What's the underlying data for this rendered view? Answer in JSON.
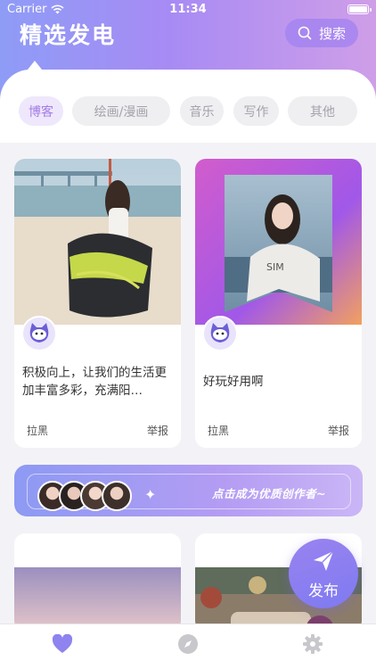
{
  "status_bar": {
    "carrier": "Carrier",
    "time": "11:34"
  },
  "header": {
    "title": "精选发电",
    "search_label": "搜索"
  },
  "categories": [
    {
      "label": "博客",
      "active": true
    },
    {
      "label": "绘画/漫画",
      "active": false
    },
    {
      "label": "音乐",
      "active": false
    },
    {
      "label": "写作",
      "active": false
    },
    {
      "label": "其他",
      "active": false
    }
  ],
  "posts": [
    {
      "text": "积极向上，让我们的生活更加丰富多彩，充满阳…",
      "block_label": "拉黑",
      "report_label": "举报"
    },
    {
      "text": "好玩好用啊",
      "block_label": "拉黑",
      "report_label": "举报"
    }
  ],
  "banner": {
    "text": "点击成为优质创作者~"
  },
  "publish": {
    "label": "发布"
  },
  "colors": {
    "accent": "#a37de8",
    "hero_start": "#8e9cf6",
    "hero_end": "#cf9ee8",
    "tab_active": "#8e83ef",
    "tab_inactive": "#c8c8cc"
  },
  "tabbar": {
    "items": [
      {
        "icon": "heart-icon",
        "active": true
      },
      {
        "icon": "compass-icon",
        "active": false
      },
      {
        "icon": "gear-icon",
        "active": false
      }
    ]
  }
}
